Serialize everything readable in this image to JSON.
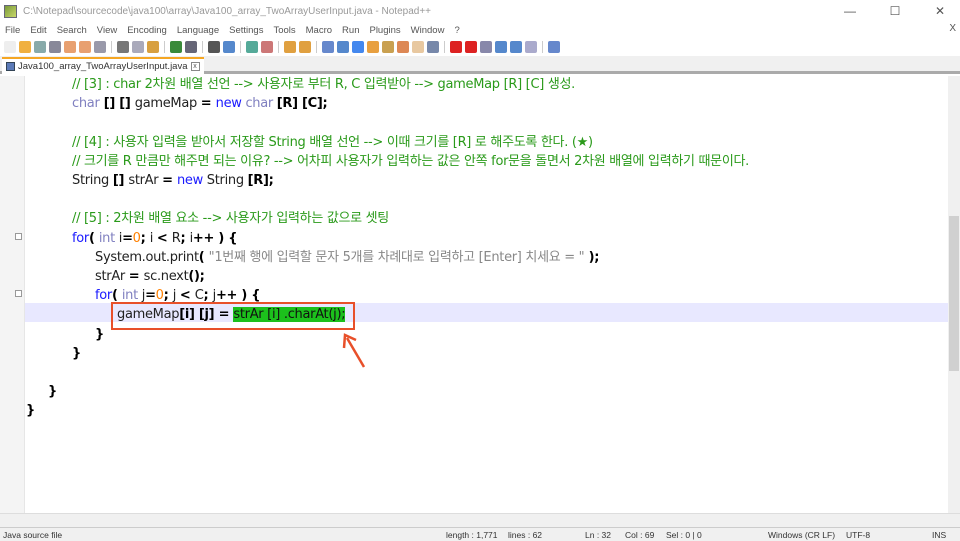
{
  "title": "C:\\Notepad\\sourcecode\\java100\\array\\Java100_array_TwoArrayUserInput.java - Notepad++",
  "menu": [
    "File",
    "Edit",
    "Search",
    "View",
    "Encoding",
    "Language",
    "Settings",
    "Tools",
    "Macro",
    "Run",
    "Plugins",
    "Window",
    "?"
  ],
  "menu_close": "X",
  "window_controls": {
    "minimize": "—",
    "maximize": "☐",
    "close": "✕"
  },
  "tab": {
    "label": "Java100_array_TwoArrayUserInput.java",
    "close": "x"
  },
  "code": [
    [
      [
        "cm",
        "// [3] : char 2차원 배열 선언 --> 사용자로 부터 R, C 입력받아 --> gameMap [R] [C] 생성."
      ]
    ],
    [
      [
        "ty",
        "char"
      ],
      [
        "op",
        " [] [] "
      ],
      [
        "",
        "gameMap "
      ],
      [
        "op",
        "= "
      ],
      [
        "kw",
        "new "
      ],
      [
        "ty",
        "char "
      ],
      [
        "op",
        "[R] [C];"
      ]
    ],
    [],
    [
      [
        "cm",
        "// [4] : 사용자 입력을 받아서 저장할 String 배열 선언 --> 이때 크기를 [R] 로 해주도록 한다. (★)"
      ]
    ],
    [
      [
        "cm",
        "// 크기를 R 만큼만 해주면 되는 이유? --> 어차피 사용자가 입력하는 값은 안쪽 for문을 돌면서 2차원 배열에 입력하기 때문이다."
      ]
    ],
    [
      [
        "",
        "String "
      ],
      [
        "op",
        "[] "
      ],
      [
        "",
        "strAr "
      ],
      [
        "op",
        "= "
      ],
      [
        "kw",
        "new "
      ],
      [
        "",
        "String "
      ],
      [
        "op",
        "[R];"
      ]
    ],
    [],
    [
      [
        "cm",
        "// [5] : 2차원 배열 요소 --> 사용자가 입력하는 값으로 셋팅"
      ]
    ],
    [
      [
        "kw",
        "for"
      ],
      [
        "op",
        "( "
      ],
      [
        "ty",
        "int "
      ],
      [
        "",
        "i"
      ],
      [
        "op",
        "="
      ],
      [
        "num",
        "0"
      ],
      [
        "op",
        "; "
      ],
      [
        "",
        "i "
      ],
      [
        "op",
        "< "
      ],
      [
        "",
        "R"
      ],
      [
        "op",
        "; "
      ],
      [
        "",
        "i"
      ],
      [
        "op",
        "++ ) {"
      ]
    ],
    [
      [
        "",
        "System.out.print"
      ],
      [
        "op",
        "( "
      ],
      [
        "str",
        "\"1번째 행에 입력할 문자 5개를 차례대로 입력하고 [Enter] 치세요 = \""
      ],
      [
        "op",
        " );"
      ]
    ],
    [
      [
        "",
        "strAr "
      ],
      [
        "op",
        "= "
      ],
      [
        "",
        "sc.next"
      ],
      [
        "op",
        "();"
      ]
    ],
    [
      [
        "kw",
        "for"
      ],
      [
        "op",
        "( "
      ],
      [
        "ty",
        "int "
      ],
      [
        "",
        "j"
      ],
      [
        "op",
        "="
      ],
      [
        "num",
        "0"
      ],
      [
        "op",
        "; "
      ],
      [
        "",
        "j "
      ],
      [
        "op",
        "< "
      ],
      [
        "",
        "C"
      ],
      [
        "op",
        "; "
      ],
      [
        "",
        "j"
      ],
      [
        "op",
        "++ ) {"
      ]
    ],
    [
      [
        "",
        "gameMap"
      ],
      [
        "op",
        "[i] [j] "
      ],
      [
        "op",
        "= "
      ],
      [
        "sel",
        "strAr [i] .charAt(j);"
      ]
    ],
    [
      [
        "op",
        "}"
      ]
    ],
    [
      [
        "op",
        "}"
      ]
    ],
    [],
    [
      [
        "op",
        "}"
      ]
    ],
    [
      [
        "op",
        "}"
      ]
    ]
  ],
  "status": {
    "file_type": "Java source file",
    "length": "length : 1,771",
    "lines": "lines : 62",
    "ln": "Ln : 32",
    "col": "Col : 69",
    "sel": "Sel : 0 | 0",
    "eol": "Windows (CR LF)",
    "encoding": "UTF-8",
    "mode": "INS"
  }
}
